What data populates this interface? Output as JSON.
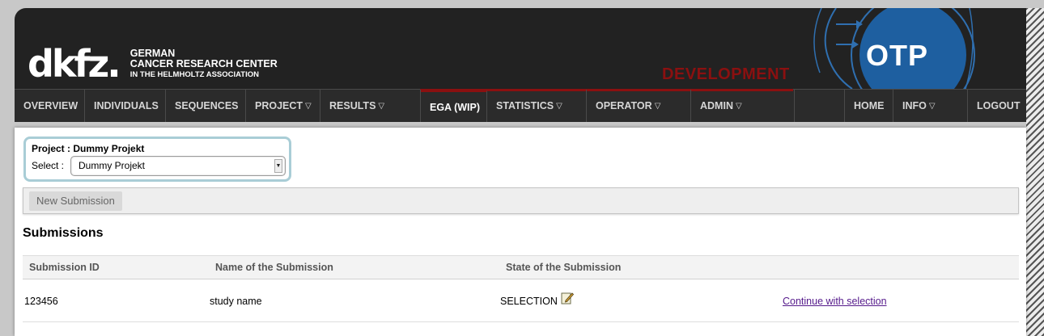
{
  "header": {
    "logo_mark": "dkfz.",
    "logo_line1": "GERMAN",
    "logo_line2": "CANCER RESEARCH CENTER",
    "logo_line3": "IN THE HELMHOLTZ ASSOCIATION",
    "environment_label": "DEVELOPMENT",
    "app_label": "OTP"
  },
  "nav": {
    "items": [
      {
        "label": "OVERVIEW",
        "arrow": ""
      },
      {
        "label": "INDIVIDUALS",
        "arrow": ""
      },
      {
        "label": "SEQUENCES",
        "arrow": ""
      },
      {
        "label": "PROJECT",
        "arrow": "▽"
      },
      {
        "label": "RESULTS",
        "arrow": "▽"
      },
      {
        "label": "EGA (WIP)",
        "arrow": ""
      },
      {
        "label": "STATISTICS",
        "arrow": "▽"
      },
      {
        "label": "OPERATOR",
        "arrow": "▽"
      },
      {
        "label": "ADMIN",
        "arrow": "▽"
      },
      {
        "label": "HOME",
        "arrow": ""
      },
      {
        "label": "INFO",
        "arrow": "▽"
      },
      {
        "label": "LOGOUT",
        "arrow": ""
      }
    ]
  },
  "project": {
    "title": "Project : Dummy Projekt",
    "select_label": "Select :",
    "selected": "Dummy Projekt"
  },
  "toolbar": {
    "new_submission": "New Submission"
  },
  "submissions": {
    "title": "Submissions",
    "columns": [
      "Submission ID",
      "Name of the Submission",
      "State of the Submission"
    ],
    "rows": [
      {
        "id": "123456",
        "name": "study name",
        "state": "SELECTION",
        "action": "Continue with selection"
      }
    ]
  },
  "colors": {
    "header_bg": "#222222",
    "accent_red": "#8b1010",
    "otp_blue": "#1e5fa0",
    "project_border": "#a9cdd6",
    "link": "#551a8b"
  }
}
